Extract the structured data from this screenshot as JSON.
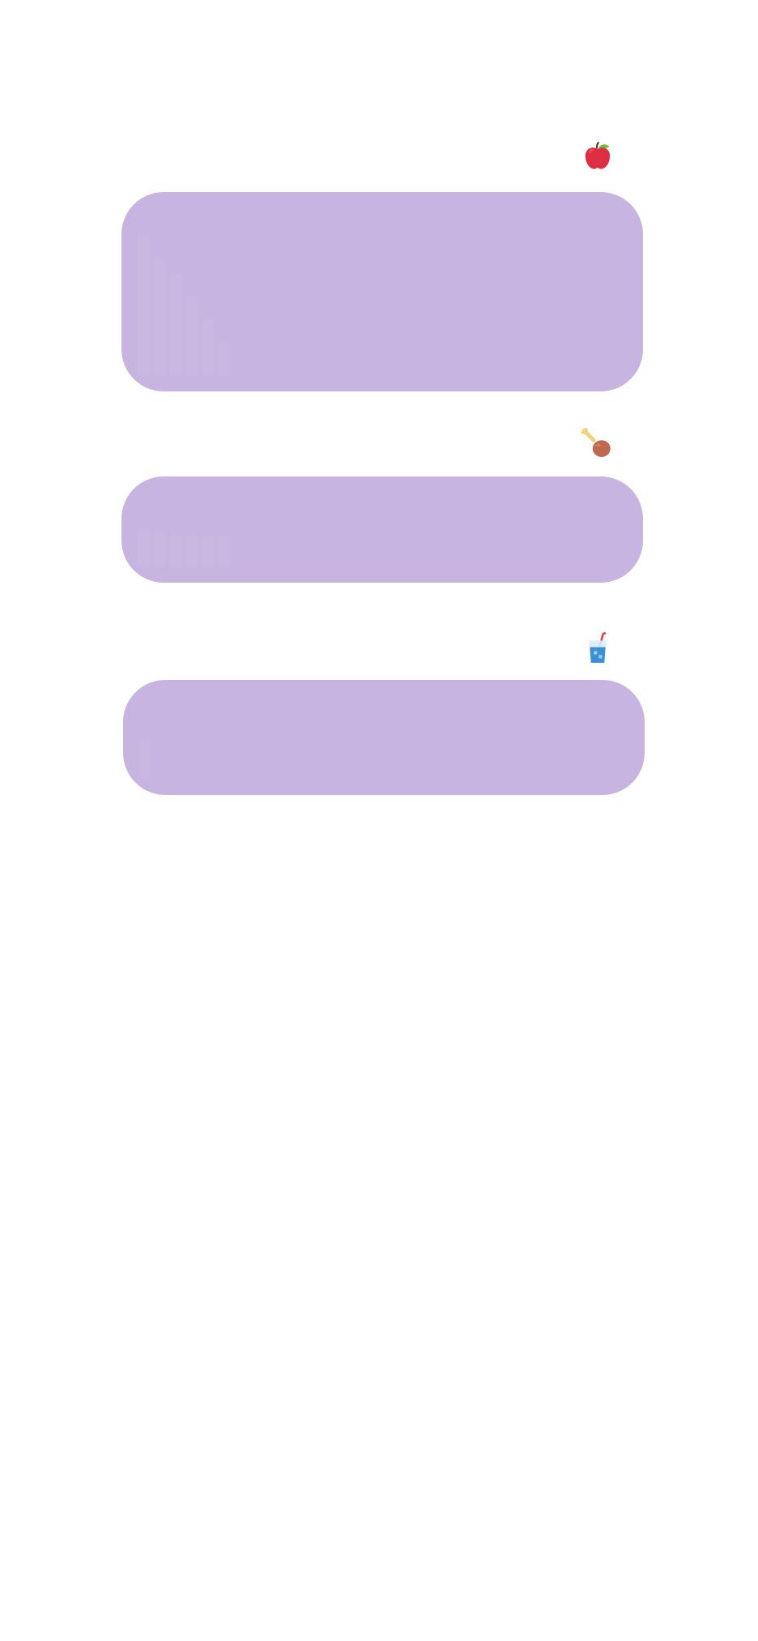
{
  "colors": {
    "background": "#ffffff",
    "card": "#c8b4e0",
    "bar_faint": "rgba(255,255,255,0.05)"
  },
  "sections": [
    {
      "id": "fruit",
      "icon": "apple-icon",
      "card_name": "fruit-card",
      "bars": [
        0.86,
        0.72,
        0.62,
        0.48,
        0.34,
        0.2
      ]
    },
    {
      "id": "protein",
      "icon": "chicken-leg-icon",
      "card_name": "protein-card",
      "bars": [
        0.54,
        0.5,
        0.46,
        0.44,
        0.43,
        0.42
      ]
    },
    {
      "id": "drink",
      "icon": "drink-glass-icon",
      "card_name": "drink-card",
      "bars": [
        0.5
      ]
    }
  ]
}
